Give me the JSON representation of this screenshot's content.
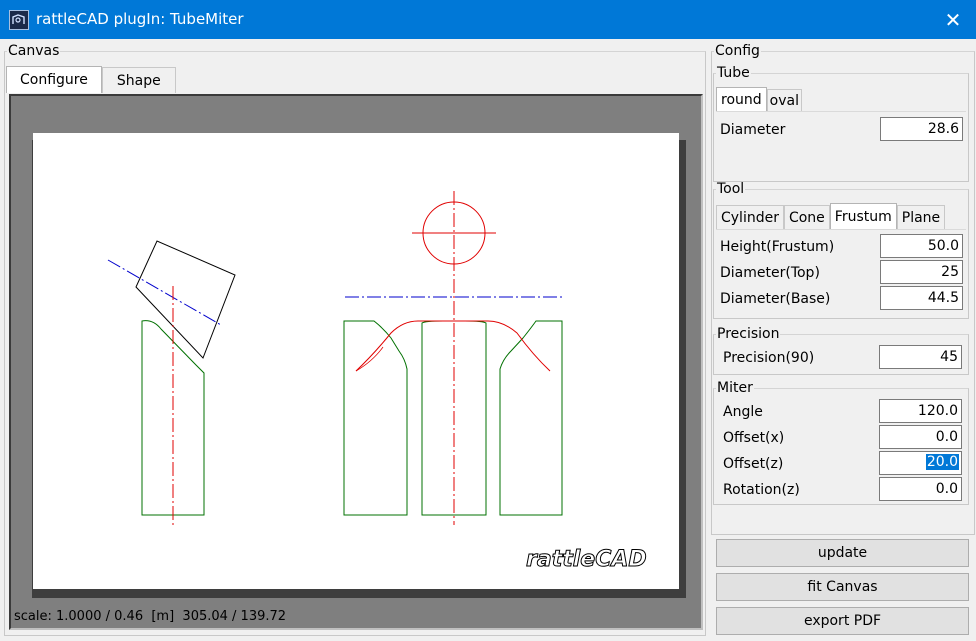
{
  "window": {
    "title": "rattleCAD plugIn: TubeMiter",
    "close_glyph": "✕"
  },
  "canvas": {
    "legend": "Canvas",
    "tabs": [
      {
        "label": "Configure",
        "active": true
      },
      {
        "label": "Shape",
        "active": false
      }
    ],
    "status": "scale: 1.0000 / 0.46  [m]  305.04 / 139.72",
    "logo_text": "rattleCAD"
  },
  "config": {
    "legend": "Config",
    "tube": {
      "legend": "Tube",
      "tabs": [
        {
          "label": "round",
          "active": true
        },
        {
          "label": "oval",
          "active": false
        }
      ],
      "fields": [
        {
          "label": "Diameter",
          "value": "28.6"
        }
      ]
    },
    "tool": {
      "legend": "Tool",
      "tabs": [
        {
          "label": "Cylinder",
          "active": false
        },
        {
          "label": "Cone",
          "active": false
        },
        {
          "label": "Frustum",
          "active": true
        },
        {
          "label": "Plane",
          "active": false
        }
      ],
      "fields": [
        {
          "label": "Height(Frustum)",
          "value": "50.0"
        },
        {
          "label": "Diameter(Top)",
          "value": "25"
        },
        {
          "label": "Diameter(Base)",
          "value": "44.5"
        }
      ]
    },
    "precision": {
      "legend": "Precision",
      "fields": [
        {
          "label": "Precision(90)",
          "value": "45"
        }
      ]
    },
    "miter": {
      "legend": "Miter",
      "fields": [
        {
          "label": "Angle",
          "value": "120.0"
        },
        {
          "label": "Offset(x)",
          "value": "0.0"
        },
        {
          "label": "Offset(z)",
          "value": "20.0",
          "selected": true
        },
        {
          "label": "Rotation(z)",
          "value": "0.0"
        }
      ]
    }
  },
  "buttons": {
    "update": "update",
    "fit_canvas": "fit Canvas",
    "export_pdf": "export PDF"
  },
  "colors": {
    "titlebar": "#0078d7",
    "tube_outline": "#007000",
    "centerline": "#e00000",
    "axis": "#0000cc",
    "selection": "#0078d7"
  }
}
